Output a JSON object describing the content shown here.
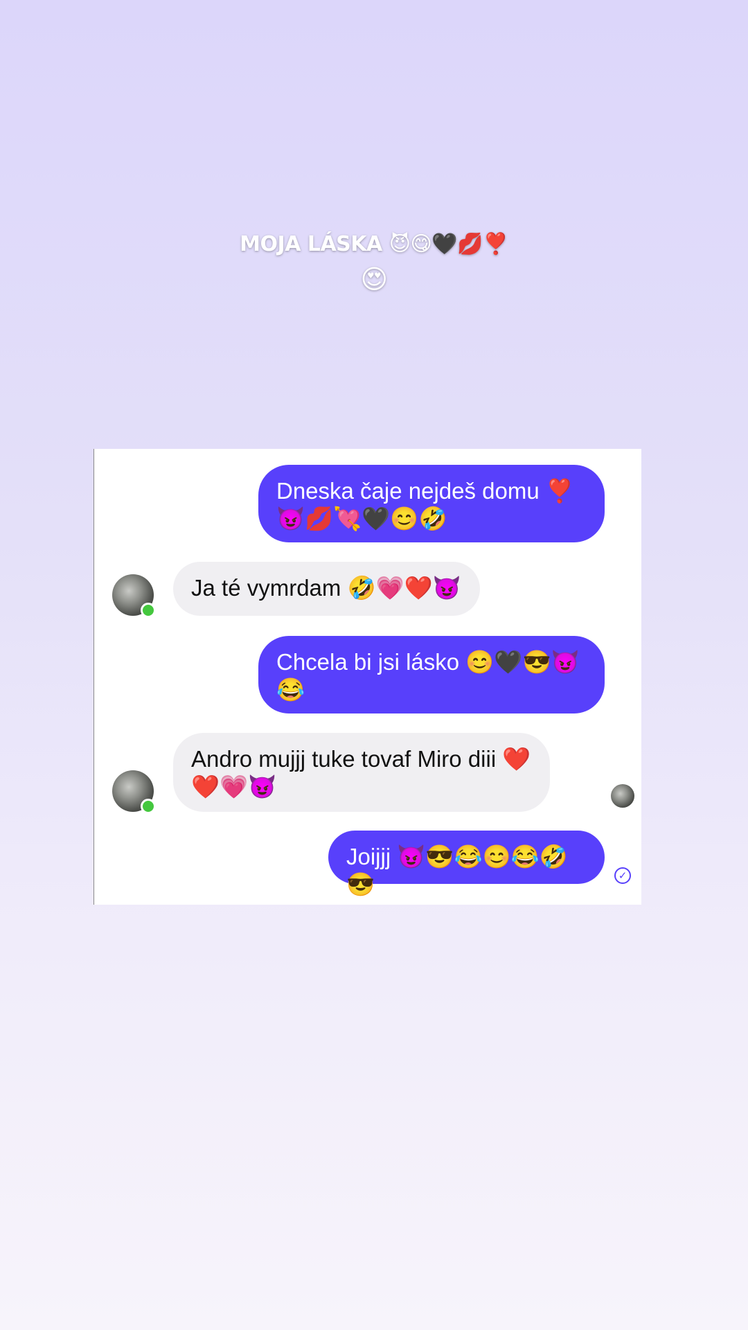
{
  "story": {
    "caption_line1": "MOJA LÁSKA 😈😋🖤💋❣️",
    "caption_line2": "😍"
  },
  "chat": {
    "messages": [
      {
        "from": "me",
        "text": "Dneska čaje nejdeš domu ❣️ 😈💋💘🖤😊🤣"
      },
      {
        "from": "them",
        "text": "Ja té vymrdam 🤣💗❤️😈"
      },
      {
        "from": "me",
        "text": "Chcela bi jsi lásko 😊🖤😎😈 😂"
      },
      {
        "from": "them",
        "text": "Andro mujjj tuke tovaf Miro diii ❤️❤️💗😈"
      },
      {
        "from": "me",
        "text": "Joijjj 😈😎😂😊😂🤣😎"
      }
    ],
    "sent_status_icon": "✓",
    "presence_color": "#44c73e",
    "accent_color": "#5840fb"
  }
}
